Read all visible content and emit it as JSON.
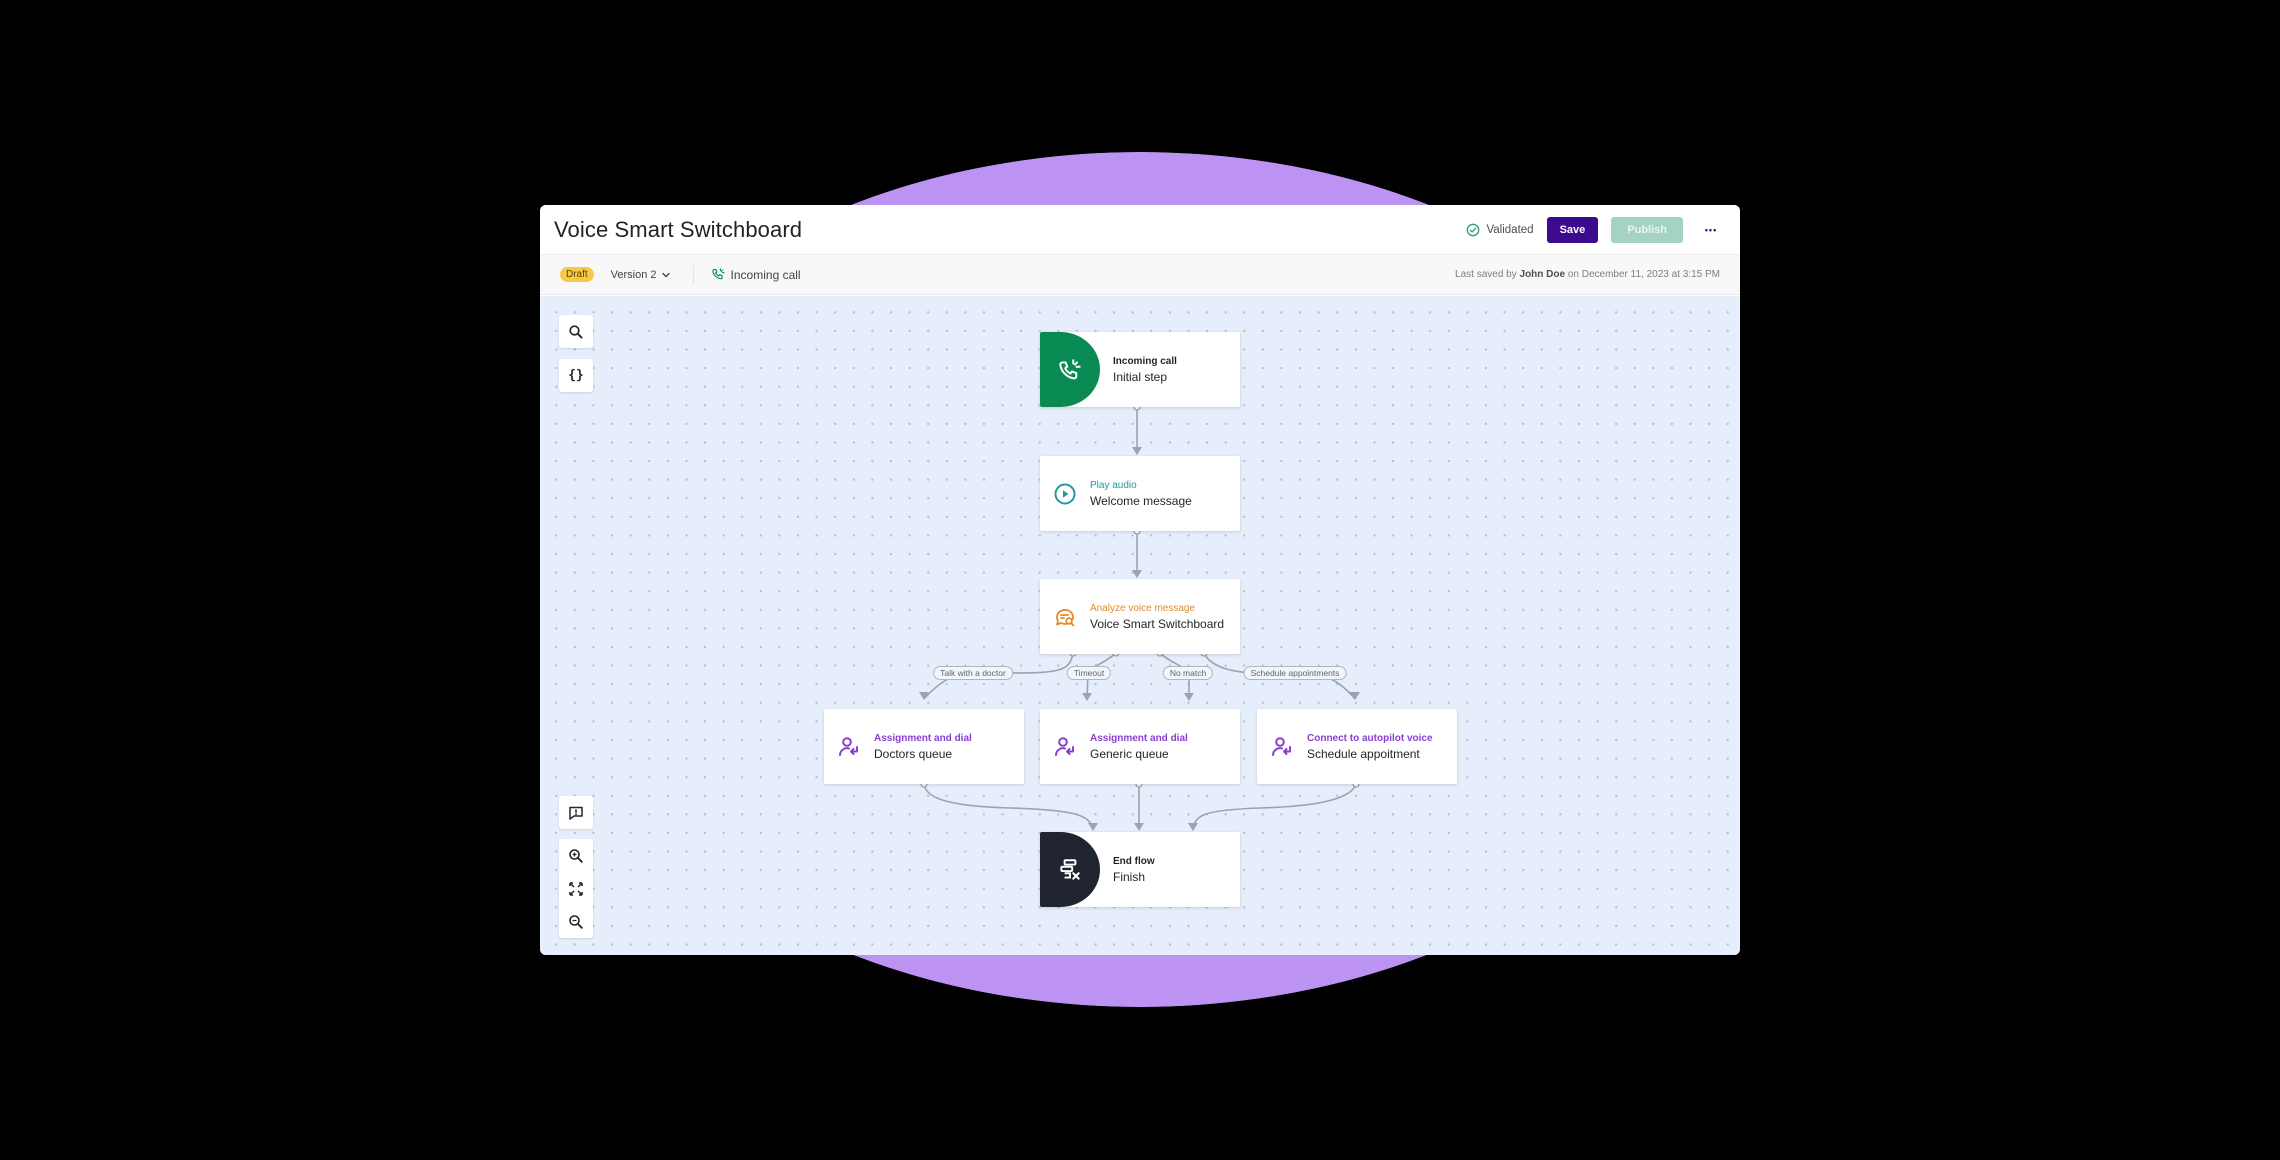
{
  "header": {
    "title": "Voice Smart Switchboard",
    "validation_status": "Validated",
    "save_label": "Save",
    "publish_label": "Publish",
    "more_label": "•••"
  },
  "subbar": {
    "status_badge": "Draft",
    "version_label": "Version 2",
    "entry_label": "Incoming call",
    "last_saved_prefix": "Last saved by",
    "last_saved_user": "John Doe",
    "last_saved_suffix": "on December 11, 2023 at 3:15 PM"
  },
  "colors": {
    "brand_primary": "#3b0a8f",
    "publish_disabled": "#a4d3c1",
    "validated_green": "#2e9e7a",
    "draft_badge": "#f7c948",
    "incoming_call_green": "#0a8a53",
    "play_audio_teal": "#1f9aa0",
    "analyze_orange": "#e48a2a",
    "assignment_purple": "#8a3fd1",
    "end_flow_dark": "#1f2430",
    "canvas_bg": "#e5eefa",
    "backdrop_circle": "#bc93f3"
  },
  "canvas_tools": {
    "top": [
      {
        "name": "search-icon",
        "label": "Search"
      },
      {
        "name": "variables-icon",
        "label": "Variables"
      }
    ],
    "bottom": [
      {
        "name": "feedback-icon",
        "label": "Report issue"
      },
      {
        "name": "zoom-in-icon",
        "label": "Zoom in"
      },
      {
        "name": "fit-view-icon",
        "label": "Fit to view"
      },
      {
        "name": "zoom-out-icon",
        "label": "Zoom out"
      }
    ]
  },
  "nodes": [
    {
      "id": "incoming",
      "kind": "Incoming call",
      "name": "Initial step",
      "icon": "incoming-call-icon"
    },
    {
      "id": "play",
      "kind": "Play audio",
      "name": "Welcome message",
      "icon": "play-icon"
    },
    {
      "id": "analyze",
      "kind": "Analyze voice message",
      "name": "Voice Smart Switchboard",
      "icon": "analyze-message-icon"
    },
    {
      "id": "doctors",
      "kind": "Assignment and dial",
      "name": "Doctors queue",
      "icon": "assign-dial-icon"
    },
    {
      "id": "generic",
      "kind": "Assignment and dial",
      "name": "Generic queue",
      "icon": "assign-dial-icon"
    },
    {
      "id": "schedule",
      "kind": "Connect to autopilot voice",
      "name": "Schedule appoitment",
      "icon": "assign-dial-icon"
    },
    {
      "id": "end",
      "kind": "End flow",
      "name": "Finish",
      "icon": "end-flow-icon"
    }
  ],
  "edges": [
    {
      "from": "incoming",
      "to": "play",
      "label": ""
    },
    {
      "from": "play",
      "to": "analyze",
      "label": ""
    },
    {
      "from": "analyze",
      "to": "doctors",
      "label": "Talk with a doctor"
    },
    {
      "from": "analyze",
      "to": "generic",
      "label": "Timeout"
    },
    {
      "from": "analyze",
      "to": "generic",
      "label": "No match"
    },
    {
      "from": "analyze",
      "to": "schedule",
      "label": "Schedule appointments"
    },
    {
      "from": "doctors",
      "to": "end",
      "label": ""
    },
    {
      "from": "generic",
      "to": "end",
      "label": ""
    },
    {
      "from": "schedule",
      "to": "end",
      "label": ""
    }
  ]
}
